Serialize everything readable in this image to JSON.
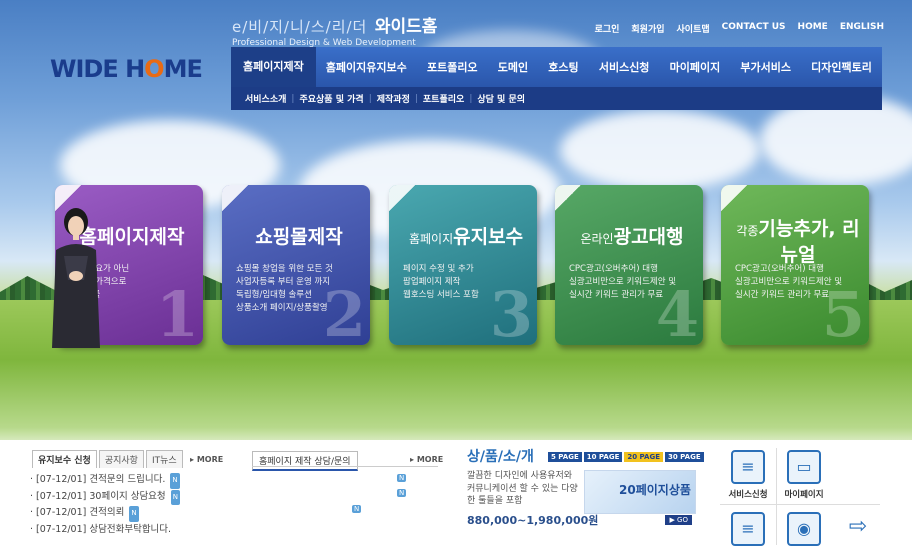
{
  "brand": {
    "logo_pre": "WIDE H",
    "logo_o": "O",
    "logo_post": "ME"
  },
  "tagline": {
    "small": "e/비/지/니/스/리/더",
    "big": "와이드홈",
    "sub": "Professional Design & Web Development"
  },
  "topnav": [
    "로그인",
    "회원가입",
    "사이트맵",
    "CONTACT US",
    "HOME",
    "ENGLISH"
  ],
  "mainnav": [
    "홈페이지제작",
    "홈페이지유지보수",
    "포트폴리오",
    "도메인",
    "호스팅",
    "서비스신청",
    "마이페이지",
    "부가서비스",
    "디자인팩토리"
  ],
  "subnav": [
    "서비스소개",
    "주요상품 및 가격",
    "제작과정",
    "포트폴리오",
    "상담 및 문의"
  ],
  "cards": [
    {
      "pre": "",
      "title": "홈페이지제작",
      "desc": [
        "이제 필요가 아닌",
        "저렴한 가격으로",
        "페이지를"
      ],
      "num": "1"
    },
    {
      "pre": "",
      "title": "쇼핑몰제작",
      "desc": [
        "쇼핑몰 창업을 위한 모든 것",
        "사업자등록 부터 운영 까지",
        "독립형/임대형 솔루션",
        "상품소개 페이지/상품촬영"
      ],
      "num": "2"
    },
    {
      "pre": "홈페이지",
      "title": "유지보수",
      "desc": [
        "페이지 수정 및 추가",
        "팝업페이지 제작",
        "웹호스팅 서비스 포함"
      ],
      "num": "3"
    },
    {
      "pre": "온라인",
      "title": "광고대행",
      "desc": [
        "CPC광고(오버추어) 대행",
        "실광고비만으로 키워드제안 및",
        "실시간 키워드 관리가 무료"
      ],
      "num": "4"
    },
    {
      "pre": "각종",
      "title": "기능추가, 리뉴얼",
      "desc": [
        "CPC광고(오버추어) 대행",
        "실광고비만으로 키워드제안 및",
        "실시간 키워드 관리가 무료"
      ],
      "num": "5"
    }
  ],
  "board": {
    "tabs": [
      "유지보수 신청",
      "공지사항",
      "IT뉴스"
    ],
    "more": "MORE",
    "items": [
      "[07-12/01] 견적문의 드립니다.",
      "[07-12/01] 30페이지 상담요청",
      "[07-12/01] 견적의뢰",
      "[07-12/01] 상담전화부탁합니다."
    ],
    "new_badge": "N"
  },
  "consult": {
    "tab": "홈페이지 제작 상담/문의",
    "more": "MORE"
  },
  "product": {
    "title": "상/품/소/개",
    "pages": [
      "5 PAGE",
      "10 PAGE",
      "20 PAGE",
      "30 PAGE"
    ],
    "selected_page": "20 PAGE",
    "desc": "깔끔한 디자인에 사용유저와 커뮤니케이션 할 수 있는 다양한 툴들을 포함",
    "price": "880,000~1,980,000원",
    "img_label": "20페이지상품",
    "go": "▶ GO"
  },
  "quick": [
    {
      "label": "서비스신청",
      "icon": "document-icon"
    },
    {
      "label": "마이페이지",
      "icon": "monitor-icon"
    },
    {
      "label": "",
      "icon": "document-icon"
    },
    {
      "label": "",
      "icon": "camera-icon"
    },
    {
      "label": "",
      "icon": "arrow-icon"
    }
  ]
}
